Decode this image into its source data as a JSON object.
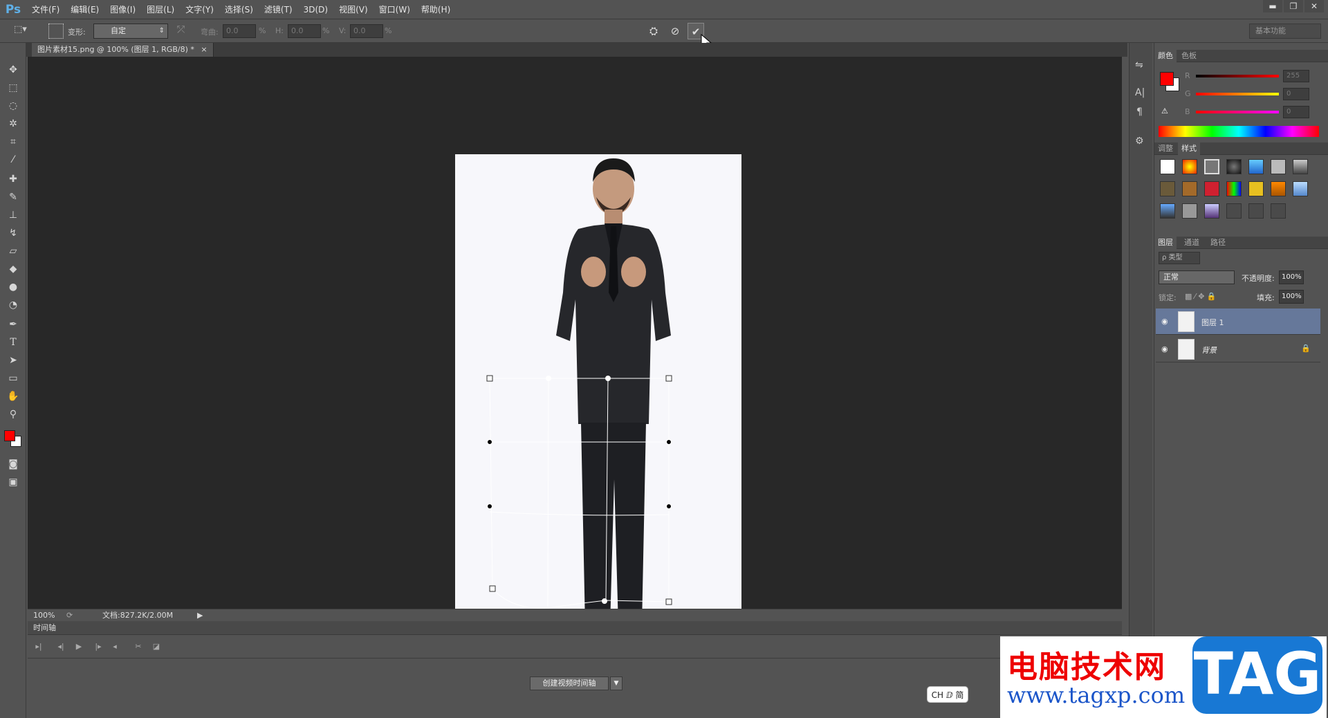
{
  "app": {
    "logo": "Ps"
  },
  "menu": [
    "文件(F)",
    "编辑(E)",
    "图像(I)",
    "图层(L)",
    "文字(Y)",
    "选择(S)",
    "滤镜(T)",
    "3D(D)",
    "视图(V)",
    "窗口(W)",
    "帮助(H)"
  ],
  "window_controls": {
    "minimize": "▬",
    "restore": "❐",
    "close": "✕"
  },
  "options": {
    "warp_label": "变形:",
    "warp_value": "自定",
    "bend_label": "弯曲:",
    "bend_value": "0.0",
    "h_label": "H:",
    "h_value": "0.0",
    "v_label": "V:",
    "v_value": "0.0",
    "percent": "%",
    "workspace": "基本功能"
  },
  "document": {
    "tab_title": "图片素材15.png @ 100% (图层 1, RGB/8) *",
    "close": "×"
  },
  "status": {
    "zoom": "100%",
    "doc_info": "文档:827.2K/2.00M"
  },
  "timeline": {
    "title": "时间轴",
    "create_button": "创建视频时间轴"
  },
  "panels": {
    "color_tabs": [
      "颜色",
      "色板"
    ],
    "color_channels": [
      {
        "label": "R",
        "value": "255"
      },
      {
        "label": "G",
        "value": "0"
      },
      {
        "label": "B",
        "value": "0"
      }
    ],
    "style_tabs": [
      "调整",
      "样式"
    ],
    "layer_tabs": [
      "图层",
      "通道",
      "路径"
    ],
    "layer_filter": "ρ 类型",
    "blend_mode": "正常",
    "opacity_label": "不透明度:",
    "opacity_value": "100%",
    "lock_label": "锁定:",
    "fill_label": "填充:",
    "fill_value": "100%",
    "layers": [
      {
        "name": "图层 1",
        "selected": true
      },
      {
        "name": "背景",
        "selected": false
      }
    ]
  },
  "colors": {
    "foreground": "#ff0000",
    "background": "#ffffff",
    "accent_selected": "#66789a"
  },
  "watermark": {
    "title": "电脑技术网",
    "url": "www.tagxp.com",
    "tag": "TAG"
  },
  "ime": "CH ⅅ 简"
}
